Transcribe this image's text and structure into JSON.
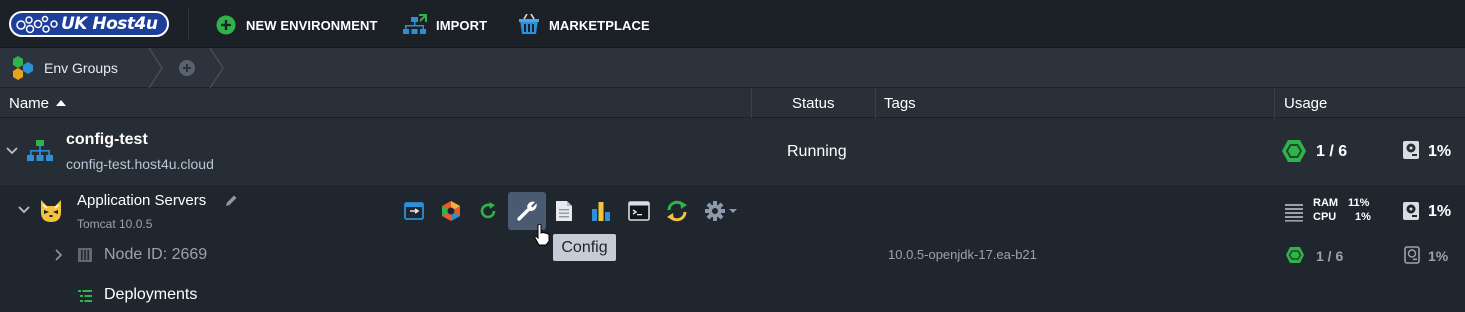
{
  "brand": {
    "logo_text": "UK Host4u"
  },
  "topbar": {
    "actions": [
      {
        "label": "NEW ENVIRONMENT",
        "icon": "plus-circle-icon"
      },
      {
        "label": "IMPORT",
        "icon": "import-icon"
      },
      {
        "label": "MARKETPLACE",
        "icon": "marketplace-basket-icon"
      }
    ]
  },
  "breadcrumb": {
    "env_groups_label": "Env Groups"
  },
  "columns": {
    "name": "Name",
    "status": "Status",
    "tags": "Tags",
    "usage": "Usage"
  },
  "environment": {
    "name": "config-test",
    "domain": "config-test.host4u.cloud",
    "status": "Running",
    "cloudlets": "1 / 6",
    "disk": "1%"
  },
  "node_group": {
    "name": "Application Servers",
    "version": "Tomcat 10.0.5",
    "ram_label": "RAM",
    "ram_value": "11%",
    "cpu_label": "CPU",
    "cpu_value": "1%",
    "disk": "1%",
    "tools": [
      "open-in-browser-icon",
      "add-ons-icon",
      "restart-icon",
      "config-wrench-icon",
      "log-icon",
      "statistics-icon",
      "web-ssh-icon",
      "redeploy-icon",
      "settings-gear-icon"
    ]
  },
  "node": {
    "label": "Node ID: 2669",
    "tag": "10.0.5-openjdk-17.ea-b21",
    "cloudlets": "1 / 6",
    "disk": "1%"
  },
  "deployments": {
    "label": "Deployments"
  },
  "tooltip": {
    "text": "Config"
  },
  "colors": {
    "topbar_bg": "#1c2128",
    "row_bg": "#272d35",
    "accent_green": "#2fb44b",
    "active_button": "#4a5a70"
  }
}
